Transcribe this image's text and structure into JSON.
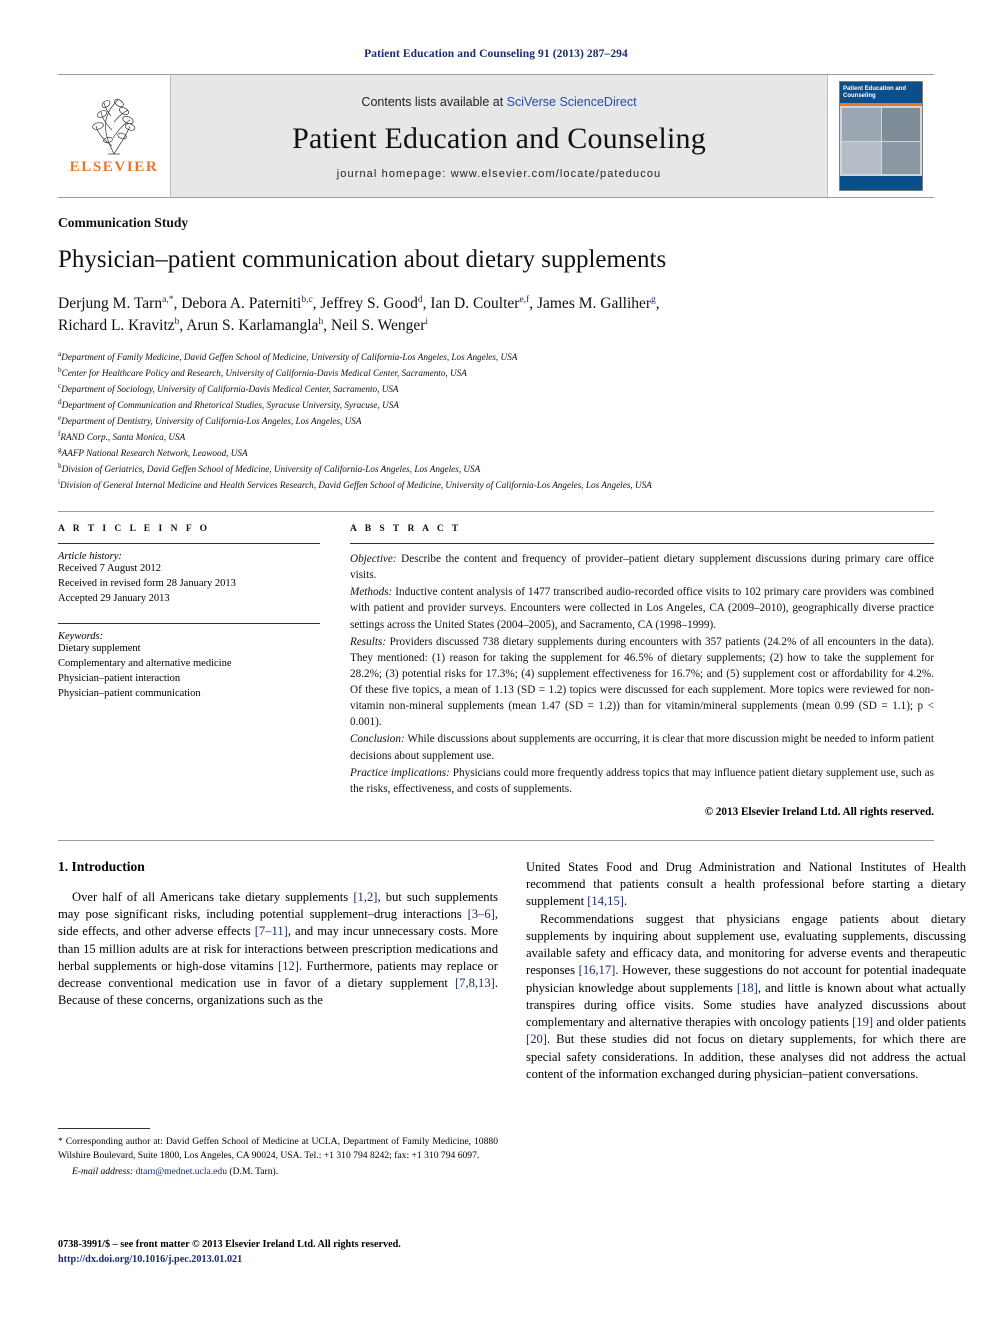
{
  "running_head": "Patient Education and Counseling 91 (2013) 287–294",
  "masthead": {
    "publisher_name": "ELSEVIER",
    "contents_prefix": "Contents lists available at ",
    "contents_link": "SciVerse ScienceDirect",
    "journal_title": "Patient Education and Counseling",
    "homepage": "journal homepage: www.elsevier.com/locate/pateducou",
    "cover_title": "Patient Education and Counseling"
  },
  "article": {
    "section_type": "Communication Study",
    "title": "Physician–patient communication about dietary supplements",
    "authors_line1": "Derjung M. Tarn a,*, Debora A. Paterniti b,c, Jeffrey S. Good d, Ian D. Coulter e,f, James M. Galliher g,",
    "authors_line2": "Richard L. Kravitz b, Arun S. Karlamangla h, Neil S. Wenger i",
    "affiliations": [
      {
        "mark": "a",
        "text": "Department of Family Medicine, David Geffen School of Medicine, University of California-Los Angeles, Los Angeles, USA"
      },
      {
        "mark": "b",
        "text": "Center for Healthcare Policy and Research, University of California-Davis Medical Center, Sacramento, USA"
      },
      {
        "mark": "c",
        "text": "Department of Sociology, University of California-Davis Medical Center, Sacramento, USA"
      },
      {
        "mark": "d",
        "text": "Department of Communication and Rhetorical Studies, Syracuse University, Syracuse, USA"
      },
      {
        "mark": "e",
        "text": "Department of Dentistry, University of California-Los Angeles, Los Angeles, USA"
      },
      {
        "mark": "f",
        "text": "RAND Corp., Santa Monica, USA"
      },
      {
        "mark": "g",
        "text": "AAFP National Research Network, Leawood, USA"
      },
      {
        "mark": "h",
        "text": "Division of Geriatrics, David Geffen School of Medicine, University of California-Los Angeles, Los Angeles, USA"
      },
      {
        "mark": "i",
        "text": "Division of General Internal Medicine and Health Services Research, David Geffen School of Medicine, University of California-Los Angeles, Los Angeles, USA"
      }
    ]
  },
  "article_info": {
    "heading": "A R T I C L E   I N F O",
    "history_label": "Article history:",
    "history": [
      "Received 7 August 2012",
      "Received in revised form 28 January 2013",
      "Accepted 29 January 2013"
    ],
    "keywords_label": "Keywords:",
    "keywords": [
      "Dietary supplement",
      "Complementary and alternative medicine",
      "Physician–patient interaction",
      "Physician–patient communication"
    ]
  },
  "abstract": {
    "heading": "A B S T R A C T",
    "sections": [
      {
        "label": "Objective:",
        "text": " Describe the content and frequency of provider–patient dietary supplement discussions during primary care office visits."
      },
      {
        "label": "Methods:",
        "text": " Inductive content analysis of 1477 transcribed audio-recorded office visits to 102 primary care providers was combined with patient and provider surveys. Encounters were collected in Los Angeles, CA (2009–2010), geographically diverse practice settings across the United States (2004–2005), and Sacramento, CA (1998–1999)."
      },
      {
        "label": "Results:",
        "text": " Providers discussed 738 dietary supplements during encounters with 357 patients (24.2% of all encounters in the data). They mentioned: (1) reason for taking the supplement for 46.5% of dietary supplements; (2) how to take the supplement for 28.2%; (3) potential risks for 17.3%; (4) supplement effectiveness for 16.7%; and (5) supplement cost or affordability for 4.2%. Of these five topics, a mean of 1.13 (SD = 1.2) topics were discussed for each supplement. More topics were reviewed for non-vitamin non-mineral supplements (mean 1.47 (SD = 1.2)) than for vitamin/mineral supplements (mean 0.99 (SD = 1.1); p < 0.001)."
      },
      {
        "label": "Conclusion:",
        "text": " While discussions about supplements are occurring, it is clear that more discussion might be needed to inform patient decisions about supplement use."
      },
      {
        "label": "Practice implications:",
        "text": " Physicians could more frequently address topics that may influence patient dietary supplement use, such as the risks, effectiveness, and costs of supplements."
      }
    ],
    "copyright": "© 2013 Elsevier Ireland Ltd. All rights reserved."
  },
  "body": {
    "intro_heading": "1. Introduction",
    "left_paragraph": "Over half of all Americans take dietary supplements [1,2], but such supplements may pose significant risks, including potential supplement–drug interactions [3–6], side effects, and other adverse effects [7–11], and may incur unnecessary costs. More than 15 million adults are at risk for interactions between prescription medications and herbal supplements or high-dose vitamins [12]. Furthermore, patients may replace or decrease conventional medication use in favor of a dietary supplement [7,8,13]. Because of these concerns, organizations such as the",
    "right_paragraph_1": "United States Food and Drug Administration and National Institutes of Health recommend that patients consult a health professional before starting a dietary supplement [14,15].",
    "right_paragraph_2": "Recommendations suggest that physicians engage patients about dietary supplements by inquiring about supplement use, evaluating supplements, discussing available safety and efficacy data, and monitoring for adverse events and therapeutic responses [16,17]. However, these suggestions do not account for potential inadequate physician knowledge about supplements [18], and little is known about what actually transpires during office visits. Some studies have analyzed discussions about complementary and alternative therapies with oncology patients [19] and older patients [20]. But these studies did not focus on dietary supplements, for which there are special safety considerations. In addition, these analyses did not address the actual content of the information exchanged during physician–patient conversations."
  },
  "footnotes": {
    "corresponding": "* Corresponding author at: David Geffen School of Medicine at UCLA, Department of Family Medicine, 10880 Wilshire Boulevard, Suite 1800, Los Angeles, CA 90024, USA. Tel.: +1 310 794 8242; fax: +1 310 794 6097.",
    "email_label": "E-mail address:",
    "email": "dtarn@mednet.ucla.edu",
    "email_suffix": " (D.M. Tarn)."
  },
  "footer": {
    "issn_line": "0738-3991/$ – see front matter © 2013 Elsevier Ireland Ltd. All rights reserved.",
    "doi": "http://dx.doi.org/10.1016/j.pec.2013.01.021"
  },
  "colors": {
    "link": "#1a2a6c",
    "elsevier_orange": "#E8762C",
    "masthead_bg": "#e6e7e8"
  }
}
